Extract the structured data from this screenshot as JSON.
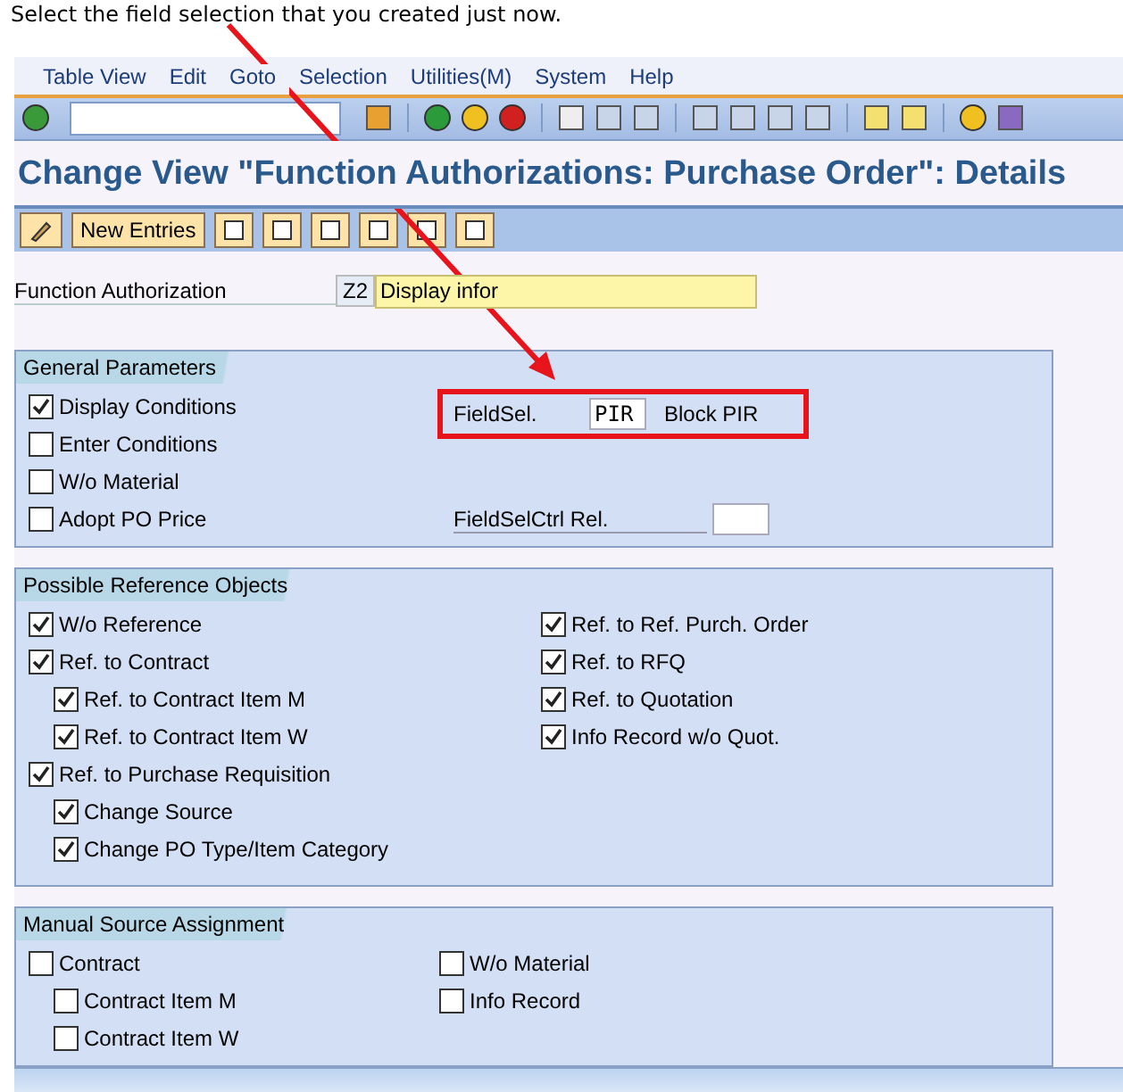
{
  "instruction": "Select the field selection that you created just now.",
  "menu": [
    "Table View",
    "Edit",
    "Goto",
    "Selection",
    "Utilities(M)",
    "System",
    "Help"
  ],
  "title": "Change View \"Function Authorizations: Purchase Order\": Details",
  "app_toolbar": {
    "button": "New Entries"
  },
  "function_authorization": {
    "label": "Function Authorization",
    "code": "Z2",
    "value": "Display infor"
  },
  "general_parameters": {
    "title": "General Parameters",
    "checkboxes": [
      {
        "label": "Display Conditions",
        "checked": true
      },
      {
        "label": "Enter Conditions",
        "checked": false
      },
      {
        "label": "W/o Material",
        "checked": false
      },
      {
        "label": "Adopt PO Price",
        "checked": false
      }
    ],
    "field_selection": {
      "label": "FieldSel.",
      "value": "PIR",
      "description": "Block PIR",
      "highlighted": true
    },
    "field_sel_ctrl_rel": {
      "label": "FieldSelCtrl Rel."
    }
  },
  "reference_objects": {
    "title": "Possible Reference Objects",
    "left": [
      {
        "label": "W/o Reference",
        "checked": true
      },
      {
        "label": "Ref. to Contract",
        "checked": true,
        "children": [
          {
            "label": "Ref. to Contract Item M",
            "checked": true
          },
          {
            "label": "Ref. to Contract Item W",
            "checked": true
          }
        ]
      },
      {
        "label": "Ref. to Purchase Requisition",
        "checked": true,
        "children": [
          {
            "label": "Change Source",
            "checked": true
          },
          {
            "label": "Change PO Type/Item Category",
            "checked": true
          }
        ]
      }
    ],
    "right": [
      {
        "label": "Ref. to Ref. Purch. Order",
        "checked": true
      },
      {
        "label": "Ref. to RFQ",
        "checked": true
      },
      {
        "label": "Ref. to Quotation",
        "checked": true
      },
      {
        "label": "Info Record w/o Quot.",
        "checked": true
      }
    ]
  },
  "manual_source": {
    "title": "Manual Source Assignment",
    "left": [
      {
        "label": "Contract",
        "checked": false,
        "children": [
          {
            "label": "Contract Item M",
            "checked": false
          },
          {
            "label": "Contract Item W",
            "checked": false
          }
        ]
      }
    ],
    "right": [
      {
        "label": "W/o Material",
        "checked": false
      },
      {
        "label": "Info Record",
        "checked": false
      }
    ]
  }
}
